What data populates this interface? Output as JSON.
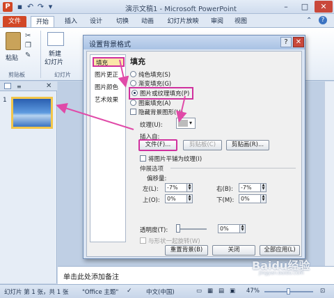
{
  "window": {
    "title": "演示文稿1 - Microsoft PowerPoint",
    "logo": "P",
    "controls": {
      "minimize": "–",
      "maximize": "□",
      "close": "✕"
    }
  },
  "tabs": [
    {
      "label": "文件",
      "active": false
    },
    {
      "label": "开始",
      "active": true
    },
    {
      "label": "插入"
    },
    {
      "label": "设计"
    },
    {
      "label": "切换"
    },
    {
      "label": "动画"
    },
    {
      "label": "幻灯片放映"
    },
    {
      "label": "审阅"
    },
    {
      "label": "视图"
    }
  ],
  "ribbon": {
    "paste_label": "粘贴",
    "clipboard_caption": "剪贴板",
    "new_slide_label_1": "新建",
    "new_slide_label_2": "幻灯片",
    "slides_caption": "幻灯片"
  },
  "slide_panel": {
    "slide_number": "1"
  },
  "notes_placeholder": "单击此处添加备注",
  "status": {
    "slide_info": "幻灯片 第 1 张，共 1 张",
    "theme": "\"Office 主题\"",
    "language": "中文(中国)",
    "zoom": "47%"
  },
  "dialog": {
    "title": "设置背景格式",
    "nav": [
      "填充",
      "图片更正",
      "图片颜色",
      "艺术效果"
    ],
    "section_title": "填充",
    "fill_options": [
      {
        "label": "纯色填充(S)",
        "selected": false
      },
      {
        "label": "渐变填充(G)",
        "selected": false
      },
      {
        "label": "图片或纹理填充(P)",
        "selected": true
      },
      {
        "label": "图案填充(A)",
        "selected": false
      }
    ],
    "hide_bg_graphics": "隐藏背景图形(H)",
    "texture_label": "纹理(U):",
    "insert_from": "插入自:",
    "file_button": "文件(F)...",
    "clipboard_button": "剪贴板(C)",
    "clipart_button": "剪贴画(R)...",
    "tile_checkbox": "将图片平铺为纹理(I)",
    "stretch_options": "伸展选项",
    "offsets": "偏移量:",
    "left_label": "左(L):",
    "left_value": "-7%",
    "right_label": "右(B):",
    "right_value": "-7%",
    "top_label": "上(O):",
    "top_value": "0%",
    "bottom_label": "下(M):",
    "bottom_value": "0%",
    "transparency_label": "透明度(T):",
    "transparency_value": "0%",
    "rotate_label": "与形状一起旋转(W)",
    "reset_button": "重置背景(B)",
    "close_button": "关闭",
    "apply_all_button": "全部应用(L)"
  },
  "watermark": {
    "text": "Baidu经验",
    "sub": "jingyan.baidu.com"
  },
  "colors": {
    "accent": "#d0309e",
    "file_tab": "#d24726"
  }
}
